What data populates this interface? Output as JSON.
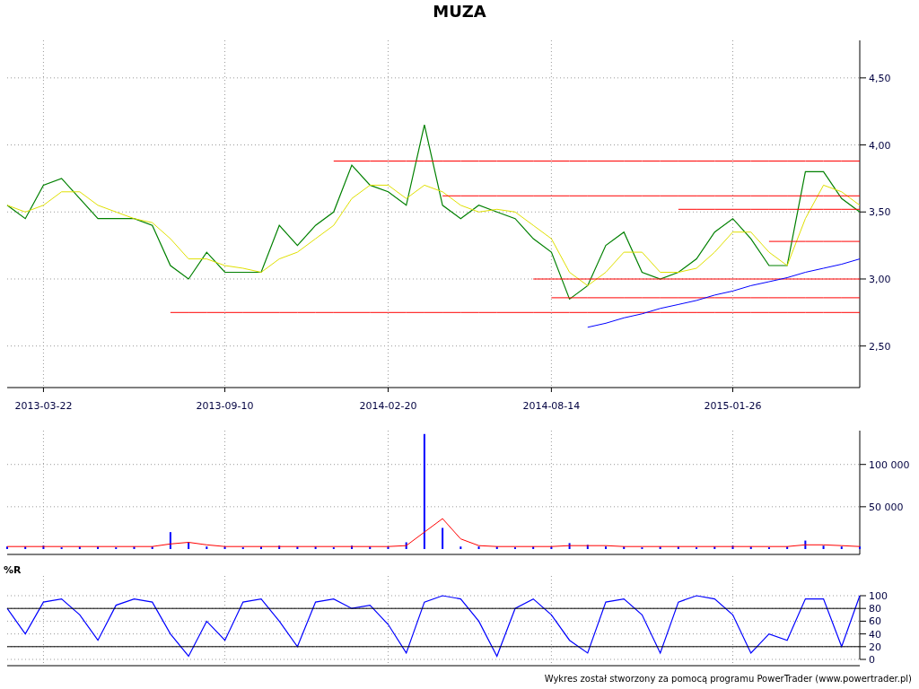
{
  "title": "MUZA",
  "price_chart": {
    "chart_data": {
      "type": "line",
      "grid": true,
      "categories": [
        null,
        null,
        "2013-03-22",
        null,
        null,
        null,
        null,
        null,
        null,
        null,
        null,
        null,
        "2013-09-10",
        null,
        null,
        null,
        null,
        null,
        null,
        null,
        null,
        "2014-02-20",
        null,
        null,
        null,
        null,
        null,
        null,
        null,
        null,
        "2014-08-14",
        null,
        null,
        null,
        null,
        null,
        null,
        null,
        null,
        null,
        "2015-01-26",
        null,
        null,
        null,
        null,
        null,
        null,
        null
      ],
      "ylim": [
        2.19,
        4.78
      ],
      "yticks": [
        {
          "value": 2.5,
          "label": "2,50"
        },
        {
          "value": 3,
          "label": "3,00"
        },
        {
          "value": 3.5,
          "label": "3,50"
        },
        {
          "value": 4,
          "label": "4,00"
        },
        {
          "value": 4.5,
          "label": "4,50"
        }
      ],
      "series": [
        {
          "color": "#008000",
          "values": [
            3.55,
            3.45,
            3.7,
            3.75,
            3.6,
            3.45,
            3.45,
            3.45,
            3.4,
            3.1,
            3.0,
            3.2,
            3.05,
            3.05,
            3.05,
            3.4,
            3.25,
            3.4,
            3.5,
            3.85,
            3.7,
            3.65,
            3.55,
            4.15,
            3.55,
            3.45,
            3.55,
            3.5,
            3.45,
            3.3,
            3.2,
            2.85,
            2.95,
            3.25,
            3.35,
            3.05,
            3.0,
            3.05,
            3.15,
            3.35,
            3.45,
            3.3,
            3.1,
            3.1,
            3.8,
            3.8,
            3.6,
            3.5
          ]
        },
        {
          "color": "#e0e000",
          "values": [
            3.55,
            3.5,
            3.55,
            3.65,
            3.65,
            3.55,
            3.5,
            3.45,
            3.42,
            3.3,
            3.15,
            3.15,
            3.1,
            3.08,
            3.05,
            3.15,
            3.2,
            3.3,
            3.4,
            3.6,
            3.7,
            3.7,
            3.6,
            3.7,
            3.65,
            3.55,
            3.5,
            3.52,
            3.5,
            3.4,
            3.3,
            3.05,
            2.95,
            3.05,
            3.2,
            3.2,
            3.05,
            3.05,
            3.08,
            3.2,
            3.35,
            3.35,
            3.2,
            3.1,
            3.45,
            3.7,
            3.65,
            3.55
          ]
        },
        {
          "color": "#ff0000",
          "values": [
            null,
            null,
            null,
            null,
            null,
            null,
            null,
            null,
            null,
            null,
            null,
            null,
            null,
            null,
            null,
            null,
            null,
            null,
            3.88,
            3.88,
            3.88,
            3.88,
            3.88,
            3.88,
            3.88,
            3.88,
            3.88,
            3.88,
            3.88,
            3.88,
            3.88,
            3.88,
            3.88,
            3.88,
            3.88,
            3.88,
            3.88,
            3.88,
            3.88,
            3.88,
            3.88,
            3.88,
            3.88,
            3.88,
            3.88,
            3.88,
            3.88,
            3.88
          ]
        },
        {
          "color": "#ff0000",
          "values": [
            null,
            null,
            null,
            null,
            null,
            null,
            null,
            null,
            null,
            null,
            null,
            null,
            null,
            null,
            null,
            null,
            null,
            null,
            null,
            null,
            null,
            null,
            null,
            null,
            3.62,
            3.62,
            3.62,
            3.62,
            3.62,
            3.62,
            3.62,
            3.62,
            3.62,
            3.62,
            3.62,
            3.62,
            3.62,
            3.62,
            3.62,
            3.62,
            3.62,
            3.62,
            3.62,
            3.62,
            3.62,
            3.62,
            3.62,
            3.62
          ]
        },
        {
          "color": "#ff0000",
          "values": [
            null,
            null,
            null,
            null,
            null,
            null,
            null,
            null,
            null,
            null,
            null,
            null,
            null,
            null,
            null,
            null,
            null,
            null,
            null,
            null,
            null,
            null,
            null,
            null,
            null,
            null,
            null,
            null,
            null,
            null,
            null,
            null,
            null,
            null,
            null,
            null,
            null,
            3.52,
            3.52,
            3.52,
            3.52,
            3.52,
            3.52,
            3.52,
            3.52,
            3.52,
            3.52,
            3.52
          ]
        },
        {
          "color": "#ff0000",
          "values": [
            null,
            null,
            null,
            null,
            null,
            null,
            null,
            null,
            null,
            null,
            null,
            null,
            null,
            null,
            null,
            null,
            null,
            null,
            null,
            null,
            null,
            null,
            null,
            null,
            null,
            null,
            null,
            null,
            null,
            null,
            null,
            null,
            null,
            null,
            null,
            null,
            null,
            null,
            null,
            null,
            null,
            null,
            3.28,
            3.28,
            3.28,
            3.28,
            3.28,
            3.28
          ]
        },
        {
          "color": "#ff0000",
          "values": [
            null,
            null,
            null,
            null,
            null,
            null,
            null,
            null,
            null,
            null,
            null,
            null,
            null,
            null,
            null,
            null,
            null,
            null,
            null,
            null,
            null,
            null,
            null,
            null,
            null,
            null,
            null,
            null,
            null,
            3.0,
            3.0,
            3.0,
            3.0,
            3.0,
            3.0,
            3.0,
            3.0,
            3.0,
            3.0,
            3.0,
            3.0,
            3.0,
            3.0,
            3.0,
            3.0,
            3.0,
            3.0,
            3.0
          ]
        },
        {
          "color": "#ff0000",
          "values": [
            null,
            null,
            null,
            null,
            null,
            null,
            null,
            null,
            null,
            null,
            null,
            null,
            null,
            null,
            null,
            null,
            null,
            null,
            null,
            null,
            null,
            null,
            null,
            null,
            null,
            null,
            null,
            null,
            null,
            null,
            2.86,
            2.86,
            2.86,
            2.86,
            2.86,
            2.86,
            2.86,
            2.86,
            2.86,
            2.86,
            2.86,
            2.86,
            2.86,
            2.86,
            2.86,
            2.86,
            2.86,
            2.86
          ]
        },
        {
          "color": "#ff0000",
          "values": [
            null,
            null,
            null,
            null,
            null,
            null,
            null,
            null,
            null,
            2.75,
            2.75,
            2.75,
            2.75,
            2.75,
            2.75,
            2.75,
            2.75,
            2.75,
            2.75,
            2.75,
            2.75,
            2.75,
            2.75,
            2.75,
            2.75,
            2.75,
            2.75,
            2.75,
            2.75,
            2.75,
            2.75,
            2.75,
            2.75,
            2.75,
            2.75,
            2.75,
            2.75,
            2.75,
            2.75,
            2.75,
            2.75,
            2.75,
            2.75,
            2.75,
            2.75,
            2.75,
            2.75,
            2.75
          ]
        },
        {
          "color": "#0000ff",
          "values": [
            null,
            null,
            null,
            null,
            null,
            null,
            null,
            null,
            null,
            null,
            null,
            null,
            null,
            null,
            null,
            null,
            null,
            null,
            null,
            null,
            null,
            null,
            null,
            null,
            null,
            null,
            null,
            null,
            null,
            null,
            null,
            null,
            2.64,
            2.67,
            2.71,
            2.74,
            2.78,
            2.81,
            2.84,
            2.88,
            2.91,
            2.95,
            2.98,
            3.01,
            3.05,
            3.08,
            3.11,
            3.15
          ]
        }
      ]
    }
  },
  "volume_chart": {
    "chart_data": {
      "type": "bar",
      "grid": true,
      "ylim": [
        0,
        140000
      ],
      "yticks": [
        {
          "value": 50000,
          "label": "50 000"
        },
        {
          "value": 100000,
          "label": "100 000"
        }
      ],
      "series": [
        {
          "color": "#0000ff",
          "values": [
            3000,
            3000,
            4000,
            2000,
            3000,
            3000,
            2000,
            3000,
            3000,
            20000,
            8000,
            3000,
            3000,
            2000,
            3000,
            4000,
            3000,
            3000,
            2000,
            4000,
            3000,
            3000,
            8000,
            136000,
            25000,
            3000,
            3000,
            3000,
            2000,
            3000,
            3000,
            7000,
            5000,
            3000,
            3000,
            2000,
            3000,
            3000,
            2000,
            3000,
            4000,
            3000,
            2000,
            3000,
            10000,
            4000,
            3000,
            3000
          ]
        },
        {
          "type": "line",
          "color": "#ff0000",
          "values": [
            3000,
            3000,
            3000,
            3000,
            3000,
            3000,
            3000,
            3000,
            3000,
            6000,
            8000,
            5000,
            3000,
            3000,
            3000,
            3000,
            3000,
            3000,
            3000,
            3000,
            3000,
            3000,
            4000,
            20000,
            36000,
            12000,
            4000,
            3000,
            3000,
            3000,
            3000,
            4000,
            4000,
            4000,
            3000,
            3000,
            3000,
            3000,
            3000,
            3000,
            3000,
            3000,
            3000,
            3000,
            5000,
            5000,
            4000,
            3000
          ]
        }
      ]
    }
  },
  "wr_chart": {
    "title": "%R",
    "chart_data": {
      "type": "line",
      "grid": true,
      "ylim": [
        0,
        100
      ],
      "yticks": [
        0,
        20,
        40,
        60,
        80,
        100
      ],
      "series": [
        {
          "color": "#0000ff",
          "values": [
            80,
            40,
            90,
            95,
            70,
            30,
            85,
            95,
            90,
            40,
            5,
            60,
            30,
            90,
            95,
            60,
            20,
            90,
            95,
            80,
            85,
            55,
            10,
            90,
            100,
            95,
            60,
            5,
            80,
            95,
            70,
            30,
            10,
            90,
            95,
            70,
            10,
            90,
            100,
            95,
            70,
            10,
            40,
            30,
            95,
            95,
            20,
            100
          ]
        },
        {
          "color": "#000000",
          "values": [
            80,
            80,
            80,
            80,
            80,
            80,
            80,
            80,
            80,
            80,
            80,
            80,
            80,
            80,
            80,
            80,
            80,
            80,
            80,
            80,
            80,
            80,
            80,
            80,
            80,
            80,
            80,
            80,
            80,
            80,
            80,
            80,
            80,
            80,
            80,
            80,
            80,
            80,
            80,
            80,
            80,
            80,
            80,
            80,
            80,
            80,
            80,
            80
          ]
        },
        {
          "color": "#000000",
          "values": [
            20,
            20,
            20,
            20,
            20,
            20,
            20,
            20,
            20,
            20,
            20,
            20,
            20,
            20,
            20,
            20,
            20,
            20,
            20,
            20,
            20,
            20,
            20,
            20,
            20,
            20,
            20,
            20,
            20,
            20,
            20,
            20,
            20,
            20,
            20,
            20,
            20,
            20,
            20,
            20,
            20,
            20,
            20,
            20,
            20,
            20,
            20,
            20
          ]
        }
      ]
    }
  },
  "footer": "Wykres został stworzony za pomocą programu PowerTrader (www.powertrader.pl)"
}
